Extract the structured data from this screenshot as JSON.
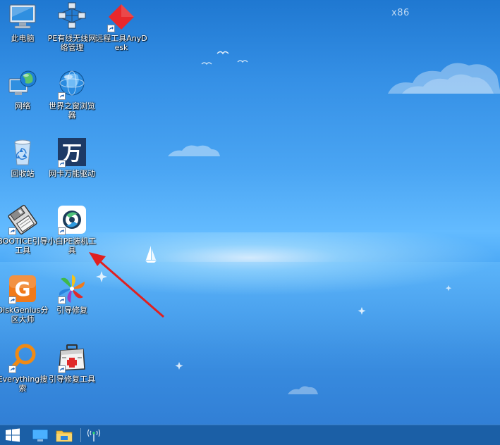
{
  "watermark": "x86",
  "icons": {
    "this_pc": {
      "label": "此电脑",
      "icon": "computer-icon"
    },
    "pe_network": {
      "label": "PE有线无线网络管理",
      "icon": "network-topology-icon"
    },
    "anydesk": {
      "label": "远程工具AnyDesk",
      "icon": "anydesk-icon"
    },
    "network": {
      "label": "网络",
      "icon": "network-globe-icon"
    },
    "browser": {
      "label": "世界之窗浏览器",
      "icon": "browser-globe-icon"
    },
    "recycle_bin": {
      "label": "回收站",
      "icon": "recycle-bin-icon"
    },
    "wan_driver": {
      "label": "网卡万能驱动",
      "icon": "wan-driver-icon",
      "glyph": "万"
    },
    "bootice": {
      "label": "BOOTICE引导工具",
      "icon": "floppy-tool-icon"
    },
    "xiaobai": {
      "label": "小白PE装机工具",
      "icon": "xiaobai-installer-icon"
    },
    "diskgenius": {
      "label": "DiskGenius分区大师",
      "icon": "diskgenius-icon",
      "glyph": "G"
    },
    "boot_repair": {
      "label": "引导修复",
      "icon": "pinwheel-icon"
    },
    "everything": {
      "label": "Everything搜索",
      "icon": "everything-search-icon"
    },
    "boot_repair_tool": {
      "label": "引导修复工具",
      "icon": "first-aid-kit-icon"
    }
  },
  "taskbar": {
    "start": {
      "icon": "windows-start-icon"
    },
    "items": [
      {
        "icon": "desktop-monitor-icon"
      },
      {
        "icon": "file-explorer-icon"
      }
    ],
    "tray": {
      "icon": "wireless-tray-icon"
    }
  },
  "colors": {
    "taskbar": "#1b5fa6",
    "arrow": "#e02020",
    "anydesk": "#e8282b",
    "diskgenius": "#f07a1a",
    "everything": "#f08a14"
  }
}
